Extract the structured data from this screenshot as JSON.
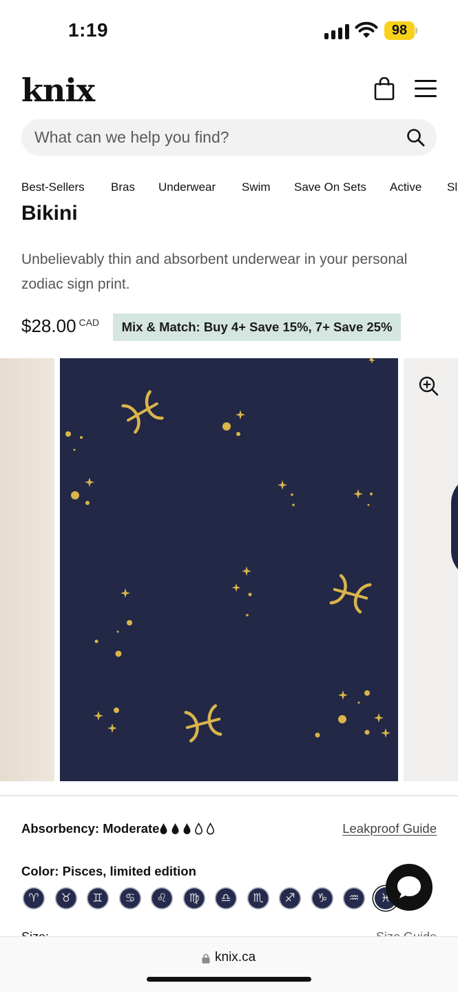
{
  "status_bar": {
    "time": "1:19",
    "battery": "98"
  },
  "header": {
    "logo": "knix"
  },
  "search": {
    "placeholder": "What can we help you find?"
  },
  "nav": {
    "items": [
      "Best-Sellers",
      "Bras",
      "Underwear",
      "Swim",
      "Save On Sets",
      "Active",
      "Sl"
    ]
  },
  "product": {
    "title": "Astrology Collection Leakproof UltraThin Bikini",
    "description": "Unbelievably thin and absorbent underwear in your personal zodiac sign print.",
    "price": "$28.00",
    "currency": "CAD",
    "promo": "Mix & Match: Buy 4+ Save 15%, 7+ Save 25%"
  },
  "absorbency": {
    "label": "Absorbency: Moderate",
    "filled_drops": 3,
    "total_drops": 5,
    "guide_link": "Leakproof Guide"
  },
  "color": {
    "label": "Color: Pisces, limited edition",
    "swatches": [
      "♈",
      "♉",
      "♊",
      "♋",
      "♌",
      "♍",
      "♎",
      "♏",
      "♐",
      "♑",
      "♒",
      "♓"
    ],
    "selected_index": 11
  },
  "size": {
    "label": "Size:",
    "guide": "Size Guide"
  },
  "browser": {
    "url": "knix.ca"
  },
  "colors": {
    "print_bg": "#222846",
    "print_gold": "#d9b54a",
    "promo_bg": "#d4e6df"
  }
}
